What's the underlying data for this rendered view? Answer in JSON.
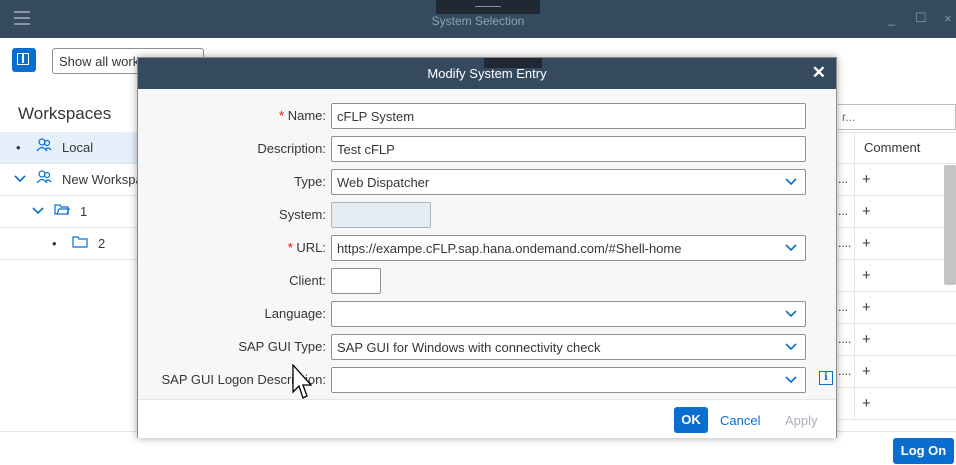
{
  "window": {
    "title": "System Selection",
    "minimize_icon": "minimize-icon",
    "maximize_icon": "maximize-icon",
    "close_icon": "close-icon"
  },
  "toolbar": {
    "workspace_select_value": "Show all workspaces"
  },
  "sidebar": {
    "heading": "Workspaces",
    "items": [
      {
        "label": "Local",
        "icon": "group-icon"
      },
      {
        "label": "New Workspace",
        "icon": "group-icon"
      },
      {
        "label": "1",
        "icon": "folder-open-icon"
      },
      {
        "label": "2",
        "icon": "folder-icon"
      }
    ]
  },
  "table": {
    "search_placeholder": "r...",
    "column_comment": "Comment",
    "rows": [
      {
        "ellipsis": "...",
        "add": "+"
      },
      {
        "ellipsis": "...",
        "add": "+"
      },
      {
        "ellipsis": "....",
        "add": "+"
      },
      {
        "ellipsis": "",
        "add": "+"
      },
      {
        "ellipsis": "...",
        "add": "+"
      },
      {
        "ellipsis": "....",
        "add": "+"
      },
      {
        "ellipsis": "....",
        "add": "+"
      },
      {
        "ellipsis": "",
        "add": "+"
      }
    ]
  },
  "logon_button": "Log On",
  "dialog": {
    "title": "Modify System Entry",
    "close_icon": "close-icon",
    "fields": {
      "name_label": "Name:",
      "name_value": "cFLP System",
      "description_label": "Description:",
      "description_value": "Test cFLP",
      "type_label": "Type:",
      "type_value": "Web Dispatcher",
      "system_label": "System:",
      "system_value": "",
      "url_label": "URL:",
      "url_value": "https://exampe.cFLP.sap.hana.ondemand.com/#Shell-home",
      "client_label": "Client:",
      "client_value": "",
      "language_label": "Language:",
      "language_value": "",
      "sapgui_type_label": "SAP GUI Type:",
      "sapgui_type_value": "SAP GUI for Windows with connectivity check",
      "sapgui_logon_label": "SAP GUI Logon Description:",
      "sapgui_logon_value": ""
    },
    "required_marker": "*",
    "ok_label": "OK",
    "cancel_label": "Cancel",
    "apply_label": "Apply"
  }
}
